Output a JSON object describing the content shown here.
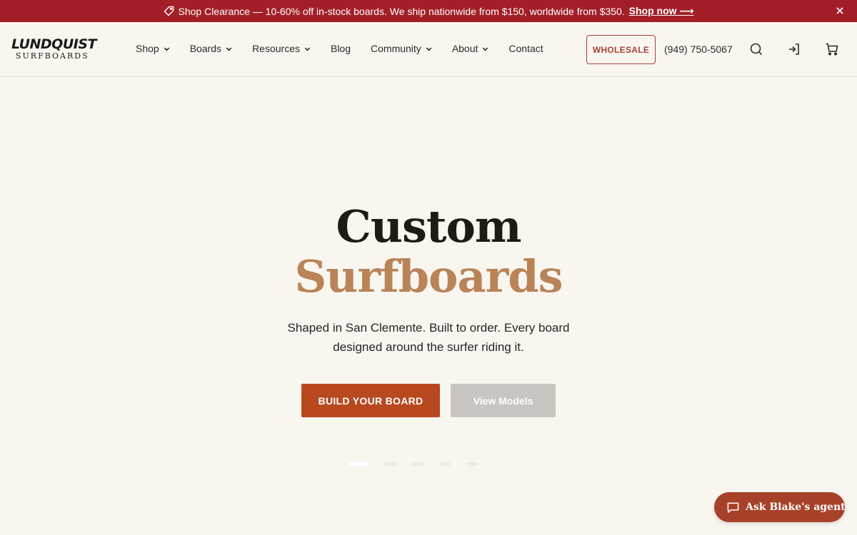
{
  "announcement": {
    "icon": "tag-icon",
    "text": "Shop Clearance — 10-60% off in-stock boards. We ship nationwide from $150, worldwide from $350.",
    "link_label": "Shop now ⟶",
    "close_icon": "close-icon"
  },
  "logo": {
    "brand": "LUNDQUIST",
    "sub": "SURFBOARDS"
  },
  "nav": {
    "items": [
      {
        "label": "Shop",
        "has_dropdown": true
      },
      {
        "label": "Boards",
        "has_dropdown": true
      },
      {
        "label": "Resources",
        "has_dropdown": true
      },
      {
        "label": "Blog",
        "has_dropdown": false
      },
      {
        "label": "Community",
        "has_dropdown": true
      },
      {
        "label": "About",
        "has_dropdown": true
      },
      {
        "label": "Contact",
        "has_dropdown": false
      }
    ]
  },
  "header": {
    "wholesale_label": "WHOLESALE",
    "phone": "(949) 750-5067",
    "icons": [
      "search-icon",
      "sign-in-icon",
      "cart-icon"
    ]
  },
  "hero": {
    "title_line1": "Custom",
    "title_line2": "Surfboards",
    "subtitle": "Shaped in San Clemente. Built to order. Every board designed around the surfer riding it.",
    "primary_cta": "BUILD YOUR BOARD",
    "secondary_cta": "View Models",
    "slides_count": 5,
    "active_slide": 1
  },
  "chat": {
    "icon": "chat-bubble-icon",
    "label": "Ask Blake's agent"
  },
  "colors": {
    "announcement_bg": "#a31f27",
    "page_bg": "#f9f6f0",
    "accent_tan": "#b88458",
    "cta_orange": "#b8491f",
    "wholesale_border": "#a8413a",
    "chat_bg": "#a8412a"
  }
}
